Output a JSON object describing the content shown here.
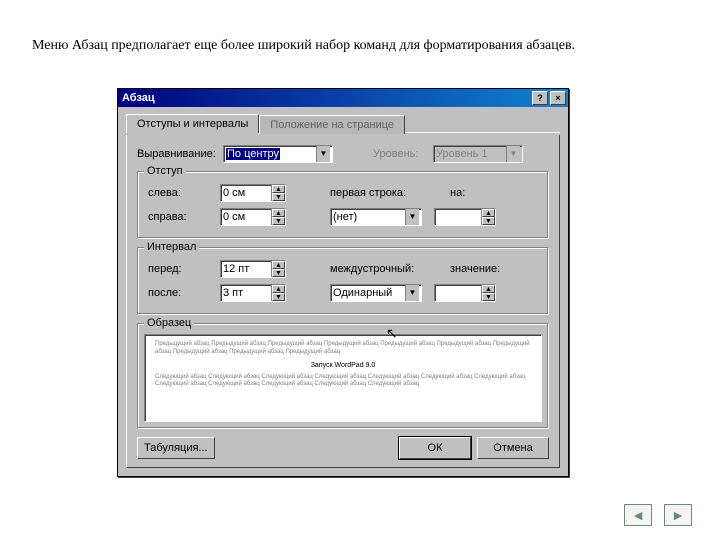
{
  "caption": "Меню Абзац предполагает еще более широкий набор команд для форматирования абзацев.",
  "dialog": {
    "title": "Абзац",
    "help_btn": "?",
    "close_btn": "×",
    "tabs": {
      "active": "Отступы и интервалы",
      "inactive": "Положение на странице"
    },
    "align_label": "Выравнивание:",
    "align_value": "По центру",
    "level_label": "Уровень:",
    "level_value": "Уровень 1",
    "indent": {
      "legend": "Отступ",
      "left_label": "слева:",
      "left_value": "0 см",
      "right_label": "справа:",
      "right_value": "0 см",
      "first_label": "первая строка:",
      "first_value": "(нет)",
      "on_label": "на:",
      "on_value": ""
    },
    "interval": {
      "legend": "Интервал",
      "before_label": "перед:",
      "before_value": "12 пт",
      "after_label": "после:",
      "after_value": "3 пт",
      "line_label": "междустрочный:",
      "line_value": "Одинарный",
      "val_label": "значение:",
      "val_value": ""
    },
    "preview": {
      "legend": "Образец",
      "lorem1": "Предыдущий абзац Предыдущий абзац Предыдущий абзац Предыдущий абзац Предыдущий абзац Предыдущий абзац Предыдущий абзац Предыдущий абзац Предыдущий абзац Предыдущий абзац",
      "sample": "Запуск WordPad 9.0",
      "lorem2": "Следующий абзац Следующий абзац Следующий абзац Следующий абзац Следующий абзац Следующий абзац Следующий абзац Следующий абзац Следующий абзац Следующий абзац Следующий абзац Следующий абзац"
    },
    "tabulation_btn": "Табуляция...",
    "ok_btn": "ОК",
    "cancel_btn": "Отмена"
  },
  "nav": {
    "prev": "◄",
    "next": "►"
  }
}
